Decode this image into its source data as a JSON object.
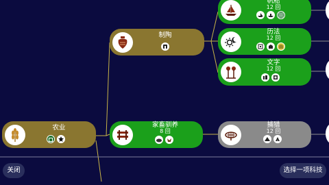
{
  "colors": {
    "background": "#0b0b3f",
    "researched": "#8a7630",
    "available": "#1ba01b",
    "locked": "#8a8a8a",
    "line_gold": "#c9b548",
    "line_grey": "#8f8f8f"
  },
  "nodes": {
    "agriculture": {
      "title": "农业",
      "icon": "wheat-icon"
    },
    "pottery": {
      "title": "制陶",
      "icon": "amphora-icon"
    },
    "animal_husbandry": {
      "title": "家畜驯养",
      "turns": "8 回",
      "icon": "pasture-fence-icon"
    },
    "sailing": {
      "title": "帆船",
      "turns": "12 回",
      "icon": "sailboat-icon"
    },
    "mysticism": {
      "title": "历法",
      "turns": "12 回",
      "icon": "sun-moon-icon"
    },
    "writing": {
      "title": "文字",
      "turns": "12 回",
      "icon": "quill-scroll-icon"
    },
    "trapping": {
      "title": "捕猎",
      "turns": "12 回",
      "icon": "net-trap-icon"
    }
  },
  "buttons": {
    "close": "关闭",
    "choose_tech": "选择一项科技"
  }
}
